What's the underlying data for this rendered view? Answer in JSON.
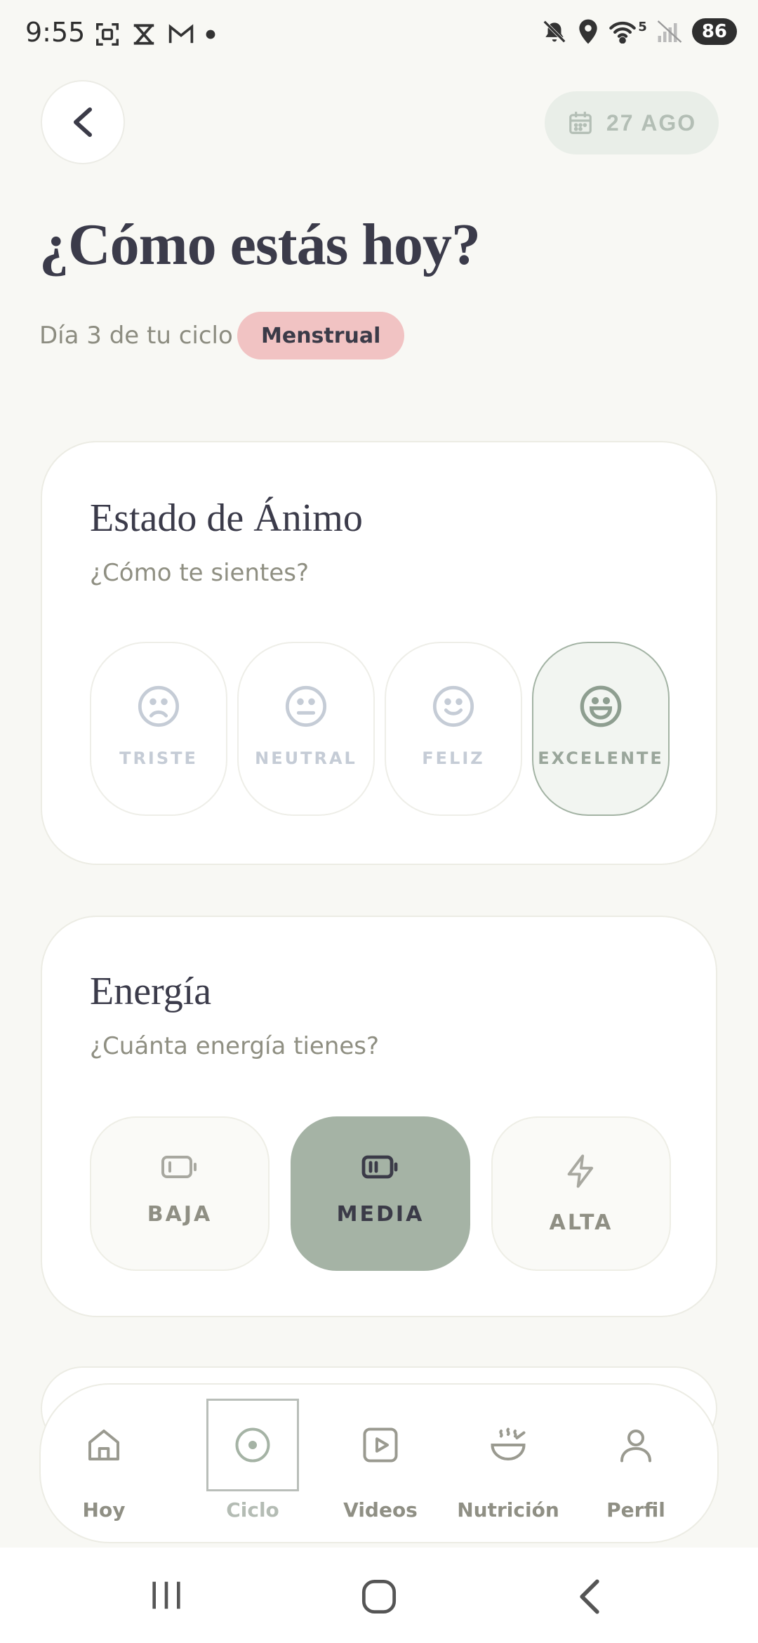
{
  "status_bar": {
    "time": "9:55",
    "battery": "86",
    "network": "5"
  },
  "header": {
    "date": "27 AGO"
  },
  "page": {
    "title": "¿Cómo estás hoy?",
    "cycle_day": "Día 3 de tu ciclo",
    "phase": "Menstrual"
  },
  "mood": {
    "title": "Estado de Ánimo",
    "subtitle": "¿Cómo te sientes?",
    "options": [
      {
        "label": "TRISTE",
        "icon": "sad-face-icon"
      },
      {
        "label": "NEUTRAL",
        "icon": "neutral-face-icon"
      },
      {
        "label": "FELIZ",
        "icon": "happy-face-icon"
      },
      {
        "label": "EXCELENTE",
        "icon": "grinning-face-icon"
      }
    ],
    "selected": "EXCELENTE"
  },
  "energy": {
    "title": "Energía",
    "subtitle": "¿Cuánta energía tienes?",
    "options": [
      {
        "label": "BAJA",
        "icon": "battery-low-icon"
      },
      {
        "label": "MEDIA",
        "icon": "battery-medium-icon"
      },
      {
        "label": "ALTA",
        "icon": "lightning-icon"
      }
    ],
    "selected": "MEDIA"
  },
  "bottom_nav": {
    "items": [
      {
        "label": "Hoy",
        "icon": "home-icon"
      },
      {
        "label": "Ciclo",
        "icon": "cycle-icon"
      },
      {
        "label": "Videos",
        "icon": "video-icon"
      },
      {
        "label": "Nutrición",
        "icon": "bowl-icon"
      },
      {
        "label": "Perfil",
        "icon": "person-icon"
      }
    ],
    "active": "Ciclo"
  },
  "colors": {
    "background": "#f8f8f4",
    "accent_sage": "#a5b3a5",
    "phase_pink": "#f1c3c3",
    "text_dark": "#3b3b4a"
  }
}
